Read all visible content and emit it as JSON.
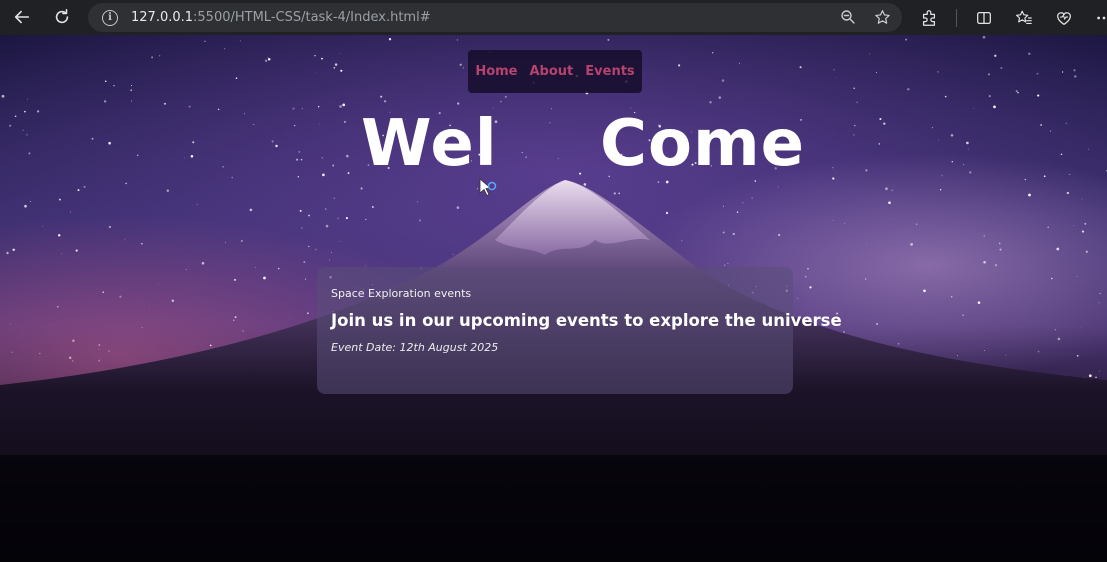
{
  "browser": {
    "url_host": "127.0.0.1",
    "url_path": ":5500/HTML-CSS/task-4/Index.html#",
    "icons": [
      "back-icon",
      "reload-icon",
      "info-icon",
      "zoom-icon",
      "star-icon",
      "extensions-icon",
      "split-screen-icon",
      "favorites-icon",
      "copilot-heart-icon",
      "more-icon"
    ]
  },
  "page": {
    "nav": {
      "home": "Home",
      "about": "About",
      "events": "Events"
    },
    "heading_left": "Wel",
    "heading_right": "Come",
    "event": {
      "tag": "Space Exploration events",
      "title": "Join us in our upcoming events to explore the universe",
      "date": "Event Date: 12th August 2025"
    }
  },
  "colors": {
    "nav_link": "#b5436e",
    "chrome_bg": "#202124",
    "heading": "#ffffff"
  }
}
